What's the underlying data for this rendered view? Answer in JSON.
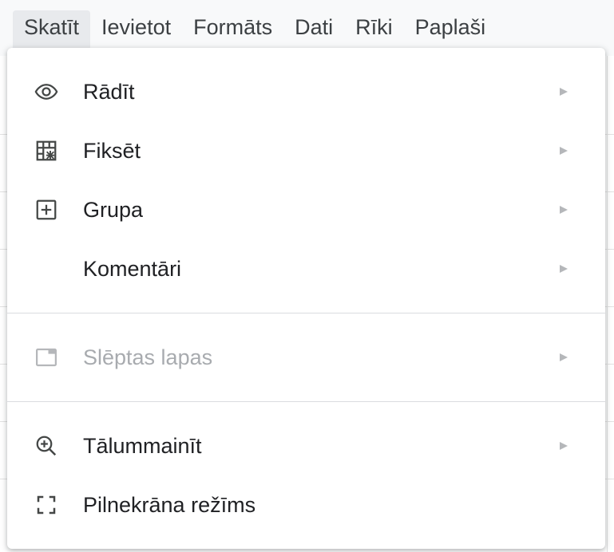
{
  "menubar": {
    "items": [
      {
        "label": "Skatīt",
        "active": true
      },
      {
        "label": "Ievietot"
      },
      {
        "label": "Formāts"
      },
      {
        "label": "Dati"
      },
      {
        "label": "Rīki"
      },
      {
        "label": "Paplaši"
      }
    ]
  },
  "dropdown": {
    "items": [
      {
        "label": "Rādīt",
        "icon": "eye-icon",
        "submenu": true
      },
      {
        "label": "Fiksēt",
        "icon": "freeze-grid-icon",
        "submenu": true
      },
      {
        "label": "Grupa",
        "icon": "group-plus-box-icon",
        "submenu": true
      },
      {
        "label": "Komentāri",
        "icon": "",
        "submenu": true
      },
      {
        "label": "Slēptas lapas",
        "icon": "hidden-sheet-icon",
        "submenu": true,
        "disabled": true
      },
      {
        "label": "Tālummainīt",
        "icon": "zoom-in-icon",
        "submenu": true
      },
      {
        "label": "Pilnekrāna režīms",
        "icon": "fullscreen-icon",
        "submenu": false
      }
    ]
  },
  "colors": {
    "text": "#202124",
    "disabled_text": "#a8abaf",
    "arrow": "#b5b7ba",
    "separator": "#dadce0",
    "menubar_active_bg": "#e8eaed"
  }
}
